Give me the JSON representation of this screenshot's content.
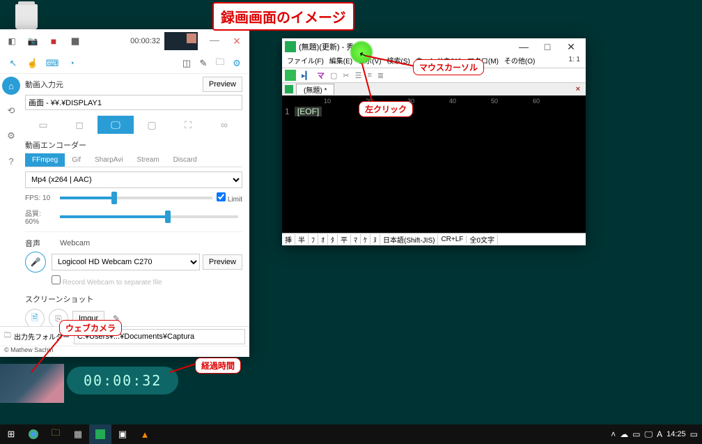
{
  "desktop": {
    "recycle_label": "ごみ箱"
  },
  "annotations": {
    "title": "録画画面のイメージ",
    "mouse_cursor": "マウスカーソル",
    "left_click": "左クリック",
    "webcam": "ウェブカメラ",
    "elapsed": "経過時間"
  },
  "captura": {
    "timer": "00:00:32",
    "video_source_label": "動画入力元",
    "preview_btn": "Preview",
    "video_source_value": "画面 - ¥¥.¥DISPLAY1",
    "encoder_label": "動画エンコーダー",
    "enc_tabs": [
      "FFmpeg",
      "Gif",
      "SharpAvi",
      "Stream",
      "Discard"
    ],
    "enc_selected": 0,
    "codec_value": "Mp4 (x264 | AAC)",
    "fps_label": "FPS:",
    "fps_value": "10",
    "limit_label": "Limit",
    "quality_label": "品質:",
    "quality_value": "60%",
    "audio_label": "音声",
    "webcam_label": "Webcam",
    "webcam_device_value": "Logicool HD Webcam C270",
    "webcam_preview": "Preview",
    "webcam_separate": "Record Webcam to separate file",
    "screenshot_label": "スクリーンショット",
    "imgur": "Imgur",
    "output_label": "出力先フォルダー",
    "output_value": "C:¥Users¥...¥Documents¥Captura",
    "copyright": "© Mathew Sachin"
  },
  "editor": {
    "title": "(無題)(更新) - 秀丸",
    "menus": [
      "ファイル(F)",
      "編集(E)",
      "表示(V)",
      "検索(S)",
      "ウィンドウ(W)",
      "マクロ(M)",
      "その他(O)"
    ],
    "position": "1: 1",
    "tab": "(無題) *",
    "line1_num": "1",
    "line1_eof": "[EOF]",
    "status_segments": [
      "挿",
      "半",
      "ﾌ",
      "ｵ",
      "ﾀ",
      "平",
      "ﾏ",
      "ｹ",
      "ﾇ"
    ],
    "status_encoding": "日本語(Shift-JIS)",
    "status_eol": "CR+LF",
    "status_width": "全0文字"
  },
  "overlay": {
    "timer": "00:00:32"
  },
  "taskbar": {
    "clock": "14:25",
    "ime": "A"
  }
}
